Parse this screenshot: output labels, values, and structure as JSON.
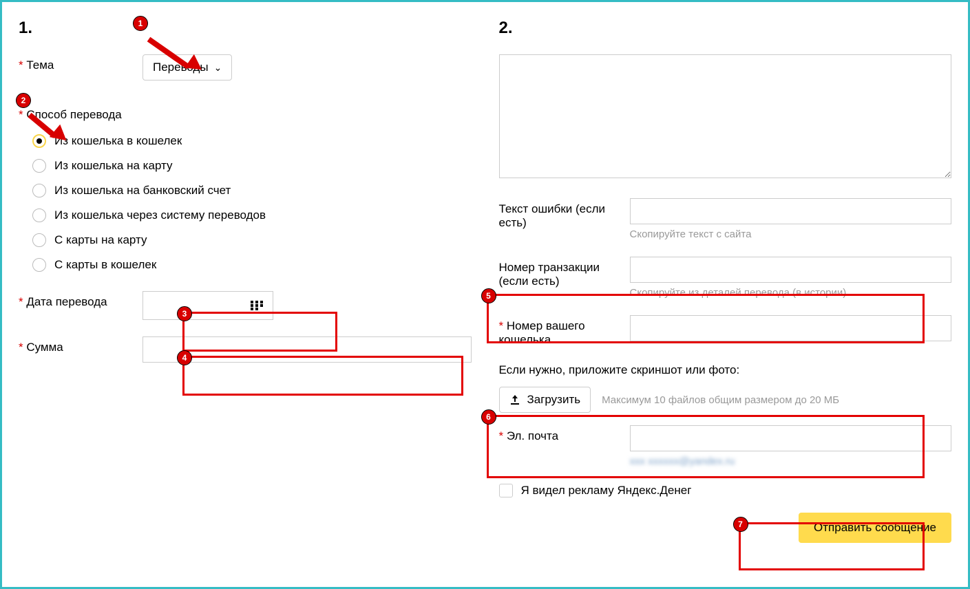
{
  "left": {
    "section_num": "1.",
    "theme_label": "Тема",
    "theme_value": "Переводы",
    "method_label": "Способ перевода",
    "methods": [
      "Из кошелька в кошелек",
      "Из кошелька на карту",
      "Из кошелька на банковский счет",
      "Из кошелька через систему переводов",
      "С карты на карту",
      "С карты в кошелек"
    ],
    "date_label": "Дата перевода",
    "sum_label": "Сумма"
  },
  "right": {
    "section_num": "2.",
    "error_label": "Текст ошибки (если есть)",
    "error_hint": "Скопируйте текст с сайта",
    "txn_label": "Номер транзакции (если есть)",
    "txn_hint": "Скопируйте из деталей перевода (в истории)",
    "wallet_label": "Номер вашего кошелька",
    "upload_heading": "Если нужно, приложите скриншот или фото:",
    "upload_btn": "Загрузить",
    "upload_hint": "Максимум 10 файлов общим размером до 20 МБ",
    "email_label": "Эл. почта",
    "email_hint": "xxx xxxxxx@yandex.ru",
    "ad_label": "Я видел рекламу Яндекс.Денег",
    "submit": "Отправить сообщение"
  },
  "annotations": {
    "b1": "1",
    "b2": "2",
    "b3": "3",
    "b4": "4",
    "b5": "5",
    "b6": "6",
    "b7": "7"
  }
}
